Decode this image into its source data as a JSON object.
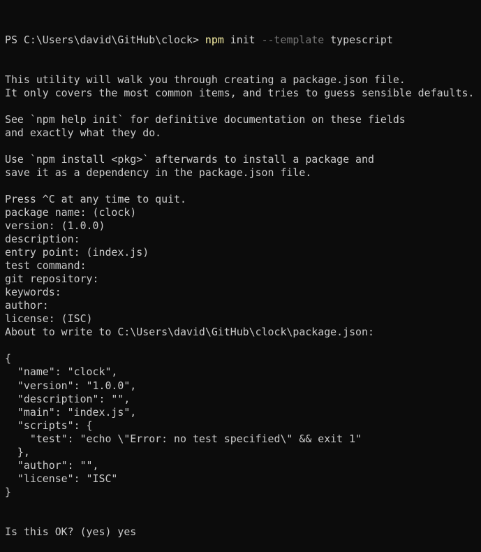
{
  "terminal": {
    "colors": {
      "background": "#0c0c0c",
      "foreground": "#cccccc",
      "command": "#f9f1a5",
      "parameter": "#767676"
    },
    "prompt": {
      "path": "PS C:\\Users\\david\\GitHub\\clock> ",
      "command": "npm",
      "arg1": " init ",
      "param": "--template",
      "arg2": " typescript"
    },
    "output": [
      "This utility will walk you through creating a package.json file.",
      "It only covers the most common items, and tries to guess sensible defaults.",
      "",
      "See `npm help init` for definitive documentation on these fields",
      "and exactly what they do.",
      "",
      "Use `npm install <pkg>` afterwards to install a package and",
      "save it as a dependency in the package.json file.",
      "",
      "Press ^C at any time to quit.",
      "package name: (clock)",
      "version: (1.0.0)",
      "description:",
      "entry point: (index.js)",
      "test command:",
      "git repository:",
      "keywords:",
      "author:",
      "license: (ISC)",
      "About to write to C:\\Users\\david\\GitHub\\clock\\package.json:",
      "",
      "{",
      "  \"name\": \"clock\",",
      "  \"version\": \"1.0.0\",",
      "  \"description\": \"\",",
      "  \"main\": \"index.js\",",
      "  \"scripts\": {",
      "    \"test\": \"echo \\\"Error: no test specified\\\" && exit 1\"",
      "  },",
      "  \"author\": \"\",",
      "  \"license\": \"ISC\"",
      "}",
      "",
      "",
      "Is this OK? (yes) yes"
    ]
  }
}
